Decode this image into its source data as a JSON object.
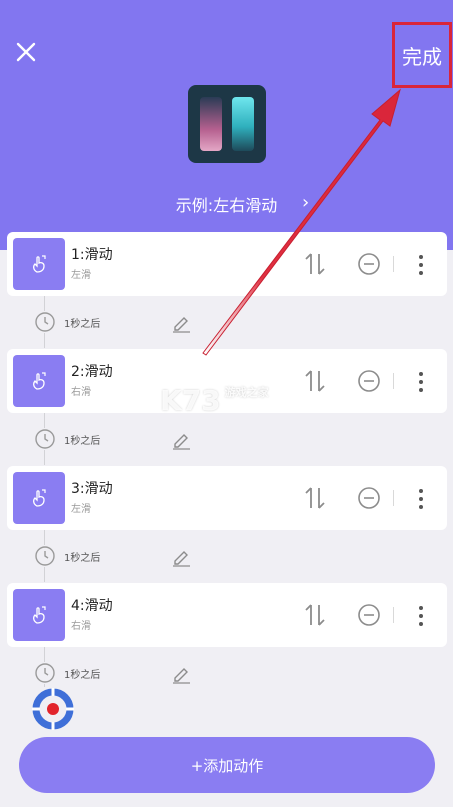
{
  "header": {
    "done_label": "完成",
    "example_title": "示例:左右滑动",
    "chevron": "›"
  },
  "actions": [
    {
      "title": "1:滑动",
      "sub": "左滑",
      "delay": "1秒之后"
    },
    {
      "title": "2:滑动",
      "sub": "右滑",
      "delay": "1秒之后"
    },
    {
      "title": "3:滑动",
      "sub": "左滑",
      "delay": "1秒之后"
    },
    {
      "title": "4:滑动",
      "sub": "右滑",
      "delay": "1秒之后"
    }
  ],
  "footer": {
    "add_label": "+添加动作"
  },
  "watermark": {
    "main": "K73",
    "small": "游戏之家"
  },
  "colors": {
    "accent": "#8276f0",
    "highlight": "#d9253a"
  },
  "icons": [
    "close-icon",
    "sort-icon",
    "minus-circle-icon",
    "more-vertical-icon",
    "clock-icon",
    "edit-icon",
    "target-icon",
    "tap-gesture-icon"
  ]
}
